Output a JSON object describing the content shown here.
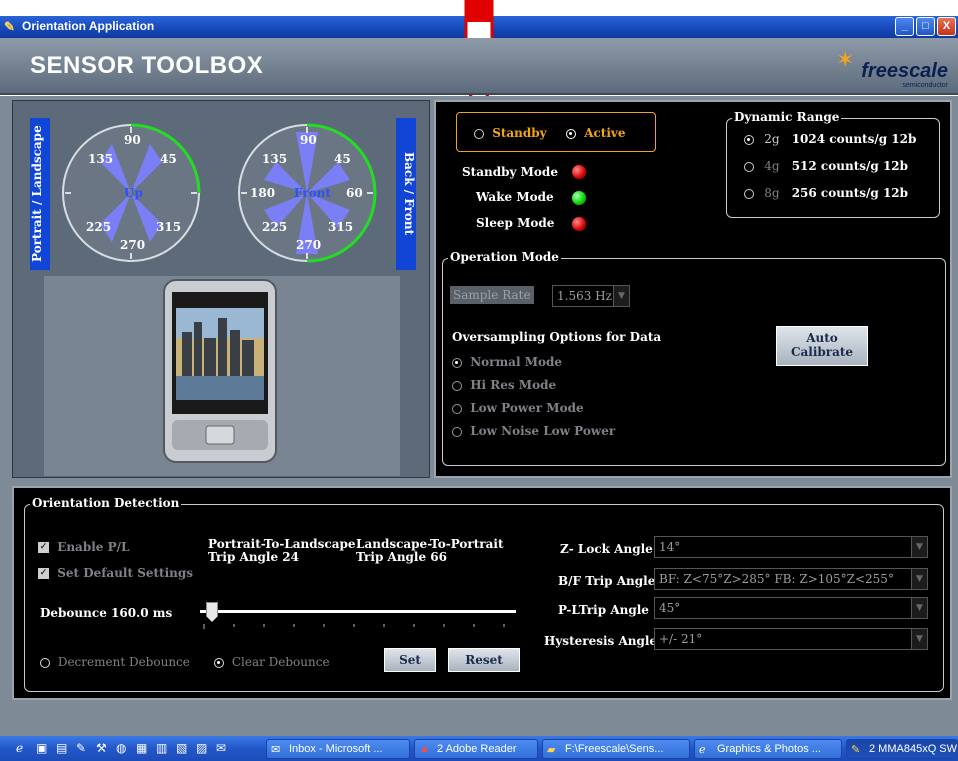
{
  "window": {
    "title": "Orientation Application",
    "minimize_glyph": "_",
    "maximize_glyph": "□",
    "close_glyph": "X"
  },
  "header": {
    "app_name": "SENSOR TOOLBOX",
    "logo_text": "freescale",
    "logo_sub": "semiconductor"
  },
  "gauges": {
    "pl": {
      "side_label": "Portrait / Landscape",
      "center_label": "Up",
      "labels": [
        "90",
        "45",
        "135",
        "225",
        "315",
        "270"
      ]
    },
    "bf": {
      "side_label": "Back / Front",
      "center_label": "Front",
      "labels": [
        "90",
        "45",
        "135",
        "180",
        "60",
        "225",
        "315",
        "270"
      ]
    }
  },
  "mode": {
    "standby_label": "Standby",
    "active_label": "Active",
    "selected": "Active"
  },
  "status": {
    "standby_label": "Standby Mode",
    "wake_label": "Wake Mode",
    "sleep_label": "Sleep Mode",
    "standby_color": "#d40000",
    "wake_color": "#00d400",
    "sleep_color": "#d40000"
  },
  "dynamic_range": {
    "title": "Dynamic Range",
    "options": [
      {
        "g": "2g",
        "desc": "1024 counts/g 12b",
        "selected": true
      },
      {
        "g": "4g",
        "desc": "512 counts/g 12b",
        "selected": false
      },
      {
        "g": "8g",
        "desc": "256 counts/g 12b",
        "selected": false
      }
    ]
  },
  "operation_mode": {
    "title": "Operation Mode",
    "sample_rate_label": "Sample Rate",
    "sample_rate_value": "1.563 Hz",
    "oversampling_title": "Oversampling Options for Data",
    "options": [
      "Normal Mode",
      "Hi Res Mode",
      "Low Power Mode",
      "Low Noise Low Power"
    ],
    "selected": "Normal Mode",
    "auto_calibrate_line1": "Auto",
    "auto_calibrate_line2": "Calibrate"
  },
  "orientation": {
    "title": "Orientation Detection",
    "enable_pl_label": "Enable P/L",
    "default_settings_label": "Set Default Settings",
    "p2l_line1": "Portrait-To-Landscape",
    "p2l_line2": "Trip Angle  24",
    "l2p_line1": "Landscape-To-Portrait",
    "l2p_line2": "Trip Angle  66",
    "debounce_label": "Debounce 160.0   ms",
    "debounce_slider_fraction": 0.02,
    "decrement_label": "Decrement Debounce",
    "clear_label": "Clear Debounce",
    "set_label": "Set",
    "reset_label": "Reset",
    "z_lock_label": "Z- Lock Angle",
    "z_lock_value": "14°",
    "bf_trip_label": "B/F Trip Angle",
    "bf_trip_value": "BF: Z<75°Z>285° FB: Z>105°Z<255°",
    "pl_trip_label": "P-LTrip Angle",
    "pl_trip_value": "45°",
    "hysteresis_label": "Hysteresis Angle",
    "hysteresis_value": "+/- 21°"
  },
  "taskbar": {
    "items": [
      {
        "icon": "mail-icon",
        "label": "Inbox - Microsoft ..."
      },
      {
        "icon": "pdf-icon",
        "label": "2 Adobe Reader"
      },
      {
        "icon": "folder-icon",
        "label": "F:\\Freescale\\Sens..."
      },
      {
        "icon": "ie-icon",
        "label": "Graphics & Photos ..."
      },
      {
        "icon": "app-icon",
        "label": "2 MMA845xQ SW"
      }
    ]
  },
  "colors": {
    "accent_orange": "#f2a51a",
    "gauge_blue": "#1145d6",
    "wedge": "#7b7ff5"
  }
}
